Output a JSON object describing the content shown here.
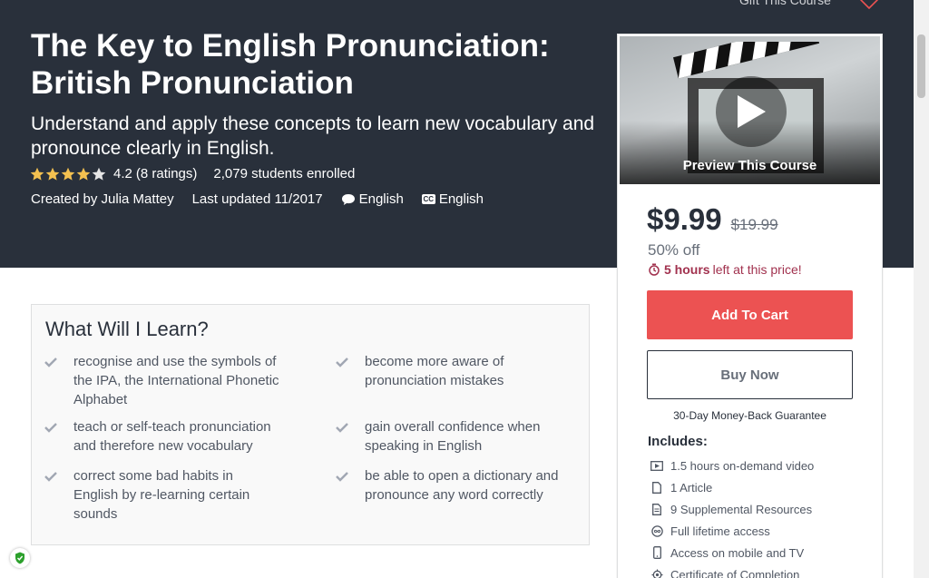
{
  "header": {
    "gift_label": "Gift This Course",
    "title": "The Key to English Pronunciation: British Pronunciation",
    "subtitle": "Understand and apply these concepts to learn new vocabulary and pronounce clearly in English.",
    "rating_value": "4.2",
    "rating_stars": 4.2,
    "rating_count": "(8 ratings)",
    "enrolled": "2,079 students enrolled",
    "created_by": "Created by Julia Mattey",
    "last_updated": "Last updated 11/2017",
    "language": "English",
    "captions": "English",
    "captions_badge": "CC"
  },
  "sidebar": {
    "preview_label": "Preview This Course",
    "price": "$9.99",
    "original_price": "$19.99",
    "discount": "50% off",
    "timer_hours": "5 hours",
    "timer_suffix": "left at this price!",
    "add_to_cart": "Add To Cart",
    "buy_now": "Buy Now",
    "guarantee": "30-Day Money-Back Guarantee",
    "includes_heading": "Includes:",
    "includes": [
      {
        "icon": "video-icon",
        "label": "1.5 hours on-demand video"
      },
      {
        "icon": "article-icon",
        "label": "1 Article"
      },
      {
        "icon": "resources-icon",
        "label": "9 Supplemental Resources"
      },
      {
        "icon": "infinity-icon",
        "label": "Full lifetime access"
      },
      {
        "icon": "mobile-icon",
        "label": "Access on mobile and TV"
      },
      {
        "icon": "certificate-icon",
        "label": "Certificate of Completion"
      }
    ]
  },
  "learn": {
    "heading": "What Will I Learn?",
    "items": [
      "recognise and use the symbols of the IPA, the International Phonetic Alphabet",
      "teach or self-teach pronunciation and therefore new vocabulary",
      "correct some bad habits in English by re-learning certain sounds",
      "become more aware of pronunciation mistakes",
      "gain overall confidence when speaking in English",
      "be able to open a dictionary and pronounce any word correctly"
    ]
  },
  "colors": {
    "hero_bg": "#29303b",
    "cart_button": "#ec5252",
    "timer": "#a1314e",
    "star": "#f4c150"
  }
}
